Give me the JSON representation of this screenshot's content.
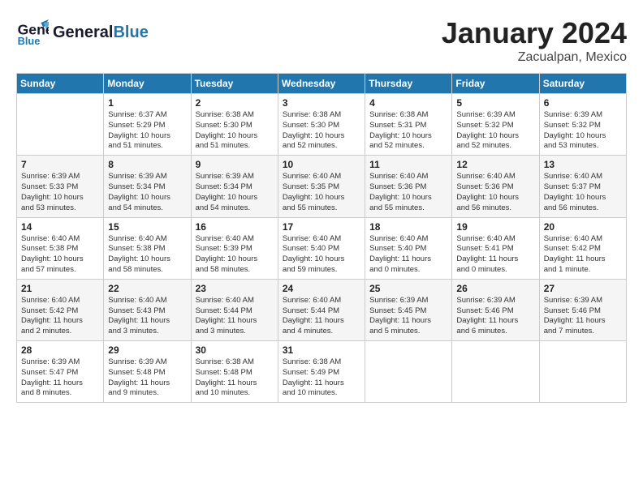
{
  "header": {
    "logo_line1": "General",
    "logo_line2": "Blue",
    "month": "January 2024",
    "location": "Zacualpan, Mexico"
  },
  "days_of_week": [
    "Sunday",
    "Monday",
    "Tuesday",
    "Wednesday",
    "Thursday",
    "Friday",
    "Saturday"
  ],
  "weeks": [
    [
      {
        "day": "",
        "info": ""
      },
      {
        "day": "1",
        "info": "Sunrise: 6:37 AM\nSunset: 5:29 PM\nDaylight: 10 hours\nand 51 minutes."
      },
      {
        "day": "2",
        "info": "Sunrise: 6:38 AM\nSunset: 5:30 PM\nDaylight: 10 hours\nand 51 minutes."
      },
      {
        "day": "3",
        "info": "Sunrise: 6:38 AM\nSunset: 5:30 PM\nDaylight: 10 hours\nand 52 minutes."
      },
      {
        "day": "4",
        "info": "Sunrise: 6:38 AM\nSunset: 5:31 PM\nDaylight: 10 hours\nand 52 minutes."
      },
      {
        "day": "5",
        "info": "Sunrise: 6:39 AM\nSunset: 5:32 PM\nDaylight: 10 hours\nand 52 minutes."
      },
      {
        "day": "6",
        "info": "Sunrise: 6:39 AM\nSunset: 5:32 PM\nDaylight: 10 hours\nand 53 minutes."
      }
    ],
    [
      {
        "day": "7",
        "info": "Sunrise: 6:39 AM\nSunset: 5:33 PM\nDaylight: 10 hours\nand 53 minutes."
      },
      {
        "day": "8",
        "info": "Sunrise: 6:39 AM\nSunset: 5:34 PM\nDaylight: 10 hours\nand 54 minutes."
      },
      {
        "day": "9",
        "info": "Sunrise: 6:39 AM\nSunset: 5:34 PM\nDaylight: 10 hours\nand 54 minutes."
      },
      {
        "day": "10",
        "info": "Sunrise: 6:40 AM\nSunset: 5:35 PM\nDaylight: 10 hours\nand 55 minutes."
      },
      {
        "day": "11",
        "info": "Sunrise: 6:40 AM\nSunset: 5:36 PM\nDaylight: 10 hours\nand 55 minutes."
      },
      {
        "day": "12",
        "info": "Sunrise: 6:40 AM\nSunset: 5:36 PM\nDaylight: 10 hours\nand 56 minutes."
      },
      {
        "day": "13",
        "info": "Sunrise: 6:40 AM\nSunset: 5:37 PM\nDaylight: 10 hours\nand 56 minutes."
      }
    ],
    [
      {
        "day": "14",
        "info": "Sunrise: 6:40 AM\nSunset: 5:38 PM\nDaylight: 10 hours\nand 57 minutes."
      },
      {
        "day": "15",
        "info": "Sunrise: 6:40 AM\nSunset: 5:38 PM\nDaylight: 10 hours\nand 58 minutes."
      },
      {
        "day": "16",
        "info": "Sunrise: 6:40 AM\nSunset: 5:39 PM\nDaylight: 10 hours\nand 58 minutes."
      },
      {
        "day": "17",
        "info": "Sunrise: 6:40 AM\nSunset: 5:40 PM\nDaylight: 10 hours\nand 59 minutes."
      },
      {
        "day": "18",
        "info": "Sunrise: 6:40 AM\nSunset: 5:40 PM\nDaylight: 11 hours\nand 0 minutes."
      },
      {
        "day": "19",
        "info": "Sunrise: 6:40 AM\nSunset: 5:41 PM\nDaylight: 11 hours\nand 0 minutes."
      },
      {
        "day": "20",
        "info": "Sunrise: 6:40 AM\nSunset: 5:42 PM\nDaylight: 11 hours\nand 1 minute."
      }
    ],
    [
      {
        "day": "21",
        "info": "Sunrise: 6:40 AM\nSunset: 5:42 PM\nDaylight: 11 hours\nand 2 minutes."
      },
      {
        "day": "22",
        "info": "Sunrise: 6:40 AM\nSunset: 5:43 PM\nDaylight: 11 hours\nand 3 minutes."
      },
      {
        "day": "23",
        "info": "Sunrise: 6:40 AM\nSunset: 5:44 PM\nDaylight: 11 hours\nand 3 minutes."
      },
      {
        "day": "24",
        "info": "Sunrise: 6:40 AM\nSunset: 5:44 PM\nDaylight: 11 hours\nand 4 minutes."
      },
      {
        "day": "25",
        "info": "Sunrise: 6:39 AM\nSunset: 5:45 PM\nDaylight: 11 hours\nand 5 minutes."
      },
      {
        "day": "26",
        "info": "Sunrise: 6:39 AM\nSunset: 5:46 PM\nDaylight: 11 hours\nand 6 minutes."
      },
      {
        "day": "27",
        "info": "Sunrise: 6:39 AM\nSunset: 5:46 PM\nDaylight: 11 hours\nand 7 minutes."
      }
    ],
    [
      {
        "day": "28",
        "info": "Sunrise: 6:39 AM\nSunset: 5:47 PM\nDaylight: 11 hours\nand 8 minutes."
      },
      {
        "day": "29",
        "info": "Sunrise: 6:39 AM\nSunset: 5:48 PM\nDaylight: 11 hours\nand 9 minutes."
      },
      {
        "day": "30",
        "info": "Sunrise: 6:38 AM\nSunset: 5:48 PM\nDaylight: 11 hours\nand 10 minutes."
      },
      {
        "day": "31",
        "info": "Sunrise: 6:38 AM\nSunset: 5:49 PM\nDaylight: 11 hours\nand 10 minutes."
      },
      {
        "day": "",
        "info": ""
      },
      {
        "day": "",
        "info": ""
      },
      {
        "day": "",
        "info": ""
      }
    ]
  ]
}
